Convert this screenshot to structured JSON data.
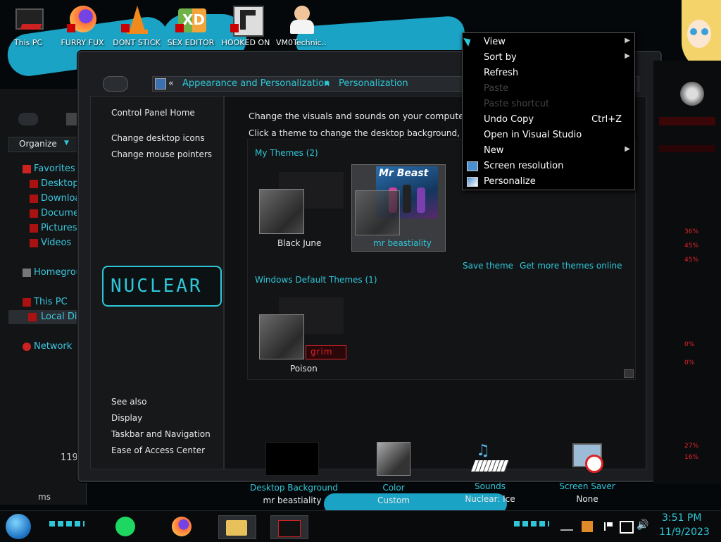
{
  "desktop_icons": [
    {
      "label": "This PC",
      "icon": "this-pc-icon"
    },
    {
      "label": "FURRY FUX",
      "icon": "firefox-icon"
    },
    {
      "label": "DONT STICK",
      "icon": "vlc-cone-icon"
    },
    {
      "label": "SEX EDITOR",
      "icon": "xd-editor-icon"
    },
    {
      "label": "HOOKED ON",
      "icon": "game-icon"
    },
    {
      "label": "VM0Technic...",
      "icon": "doctor-icon"
    }
  ],
  "explorer": {
    "organize_label": "Organize",
    "nav": {
      "favorites": "Favorites",
      "desktop": "Desktop",
      "downloads": "Downloac",
      "documents": "Documen",
      "pictures": "Pictures",
      "videos": "Videos",
      "homegroup": "Homegroup",
      "this_pc": "This PC",
      "local_disk": "Local Dis",
      "network": "Network"
    },
    "item_count": "119",
    "status_fragment": "ms"
  },
  "window": {
    "breadcrumb": {
      "sep": "«",
      "parent": "Appearance and Personalization",
      "current": "Personalization"
    },
    "sidebar": {
      "home": "Control Panel Home",
      "links": [
        "Change desktop icons",
        "Change mouse pointers"
      ],
      "logo_text": "NUCLEAR",
      "see_also": "See also",
      "see_also_links": [
        "Display",
        "Taskbar and Navigation",
        "Ease of Access Center"
      ]
    },
    "heading": "Change the visuals and sounds on your computer",
    "subheading": "Click a theme to change the desktop background, color, s",
    "my_themes": {
      "title": "My Themes (2)",
      "themes": [
        {
          "name": "Black June"
        },
        {
          "name": "mr beastiality",
          "selected": true,
          "banner": "Mr Beast"
        }
      ]
    },
    "save_theme": "Save theme",
    "get_more": "Get more themes online",
    "default_themes": {
      "title": "Windows Default Themes (1)",
      "themes": [
        {
          "name": "Poison",
          "badge": "grim"
        }
      ]
    },
    "bottom": [
      {
        "title": "Desktop Background",
        "value": "mr beastiality",
        "icon": "desktop-background-icon"
      },
      {
        "title": "Color",
        "value": "Custom",
        "icon": "color-swatch-icon"
      },
      {
        "title": "Sounds",
        "value": "Nuclear: Ice",
        "icon": "sounds-piano-icon"
      },
      {
        "title": "Screen Saver",
        "value": "None",
        "icon": "screen-saver-icon"
      }
    ]
  },
  "context_menu": {
    "items": [
      {
        "label": "View",
        "arrow": true
      },
      {
        "label": "Sort by",
        "arrow": true
      },
      {
        "label": "Refresh"
      },
      {
        "label": "Paste",
        "disabled": true
      },
      {
        "label": "Paste shortcut",
        "disabled": true
      },
      {
        "label": "Undo Copy",
        "shortcut": "Ctrl+Z"
      },
      {
        "label": "Open in Visual Studio"
      },
      {
        "label": "New",
        "arrow": true
      },
      {
        "label": "Screen resolution",
        "icon": "screen-resolution-icon"
      },
      {
        "label": "Personalize",
        "icon": "personalize-icon"
      }
    ]
  },
  "gadget": {
    "values": [
      "36%",
      "45%",
      "45%",
      "0%",
      "0%",
      "27%",
      "16%"
    ]
  },
  "taskbar": {
    "time": "3:51 PM",
    "date": "11/9/2023"
  },
  "colors": {
    "accent_cyan": "#2fc7d8",
    "gadget_red": "#e0232b",
    "wallpaper_cyan": "#1aa3c4"
  }
}
